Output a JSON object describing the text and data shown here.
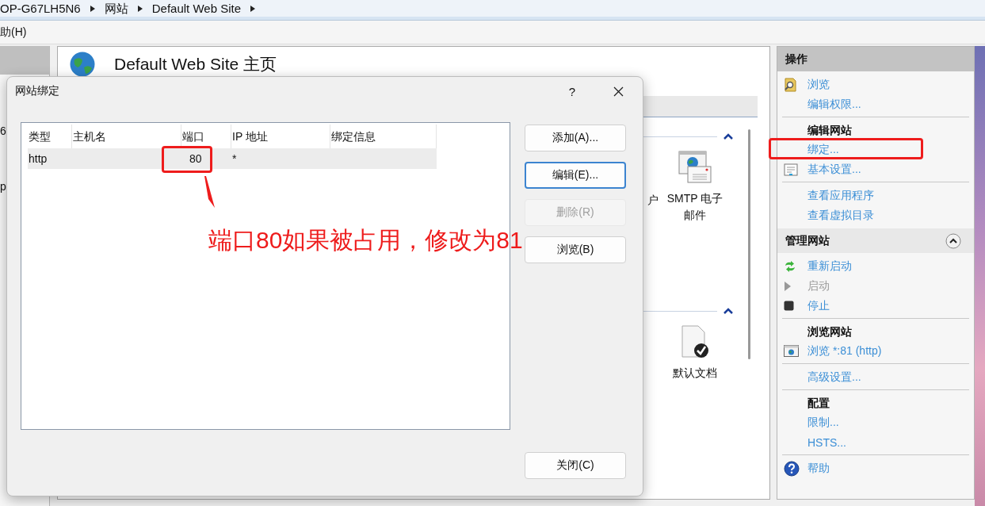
{
  "breadcrumb": [
    "OP-G67LH5N6",
    "网站",
    "Default Web Site"
  ],
  "menu": [
    "助(H)"
  ],
  "tree": [
    "6",
    "p"
  ],
  "page": {
    "title": "Default Web Site 主页",
    "groups": [
      {
        "expanded": true,
        "features": [
          {
            "kind": "partial",
            "label": "户"
          },
          {
            "kind": "smtp",
            "label": "SMTP 电子邮件"
          }
        ]
      },
      {
        "expanded": true,
        "features": [
          {
            "kind": "document",
            "label": "默认文档"
          }
        ]
      }
    ]
  },
  "actions": [
    {
      "title": "操作",
      "kind": "primary",
      "groups": [
        {
          "items": [
            {
              "kind": "browse",
              "label": "浏览",
              "disabled": false
            },
            {
              "kind": "plain",
              "label": "编辑权限...",
              "disabled": false
            }
          ]
        },
        {
          "heading": "编辑网站",
          "items": [
            {
              "kind": "plain",
              "label": "绑定...",
              "disabled": false
            },
            {
              "kind": "settings",
              "label": "基本设置...",
              "disabled": false
            }
          ]
        },
        {
          "items": [
            {
              "kind": "plain",
              "label": "查看应用程序",
              "disabled": false
            },
            {
              "kind": "plain",
              "label": "查看虚拟目录",
              "disabled": false
            }
          ]
        }
      ]
    },
    {
      "title": "管理网站",
      "kind": "secondary",
      "expanded": true,
      "groups": [
        {
          "items": [
            {
              "kind": "restart",
              "label": "重新启动",
              "disabled": false
            },
            {
              "kind": "start",
              "label": "启动",
              "disabled": true
            },
            {
              "kind": "stop",
              "label": "停止",
              "disabled": false
            }
          ]
        },
        {
          "heading": "浏览网站",
          "items": [
            {
              "kind": "browser",
              "label": "浏览 *:81 (http)",
              "disabled": false
            }
          ]
        },
        {
          "items": [
            {
              "kind": "plain",
              "label": "高级设置...",
              "disabled": false
            }
          ]
        },
        {
          "heading": "配置",
          "items": [
            {
              "kind": "plain",
              "label": "限制...",
              "disabled": false
            },
            {
              "kind": "plain",
              "label": "HSTS...",
              "disabled": false
            }
          ]
        },
        {
          "items": [
            {
              "kind": "help",
              "label": "帮助",
              "disabled": false
            }
          ]
        }
      ]
    }
  ],
  "dialog": {
    "title": "网站绑定",
    "help": "?",
    "columns": [
      "类型",
      "主机名",
      "端口",
      "IP 地址",
      "绑定信息"
    ],
    "rows": [
      {
        "selected": true,
        "cells": [
          "http",
          "",
          "80",
          "*",
          ""
        ]
      }
    ],
    "buttons": [
      {
        "label": "添加(A)...",
        "focused": false,
        "disabled": false
      },
      {
        "label": "编辑(E)...",
        "focused": true,
        "disabled": false
      },
      {
        "label": "删除(R)",
        "focused": false,
        "disabled": true
      },
      {
        "label": "浏览(B)",
        "focused": false,
        "disabled": false
      }
    ],
    "close_button": "关闭(C)"
  },
  "annotation": {
    "note": "端口80如果被占用，修改为81"
  }
}
